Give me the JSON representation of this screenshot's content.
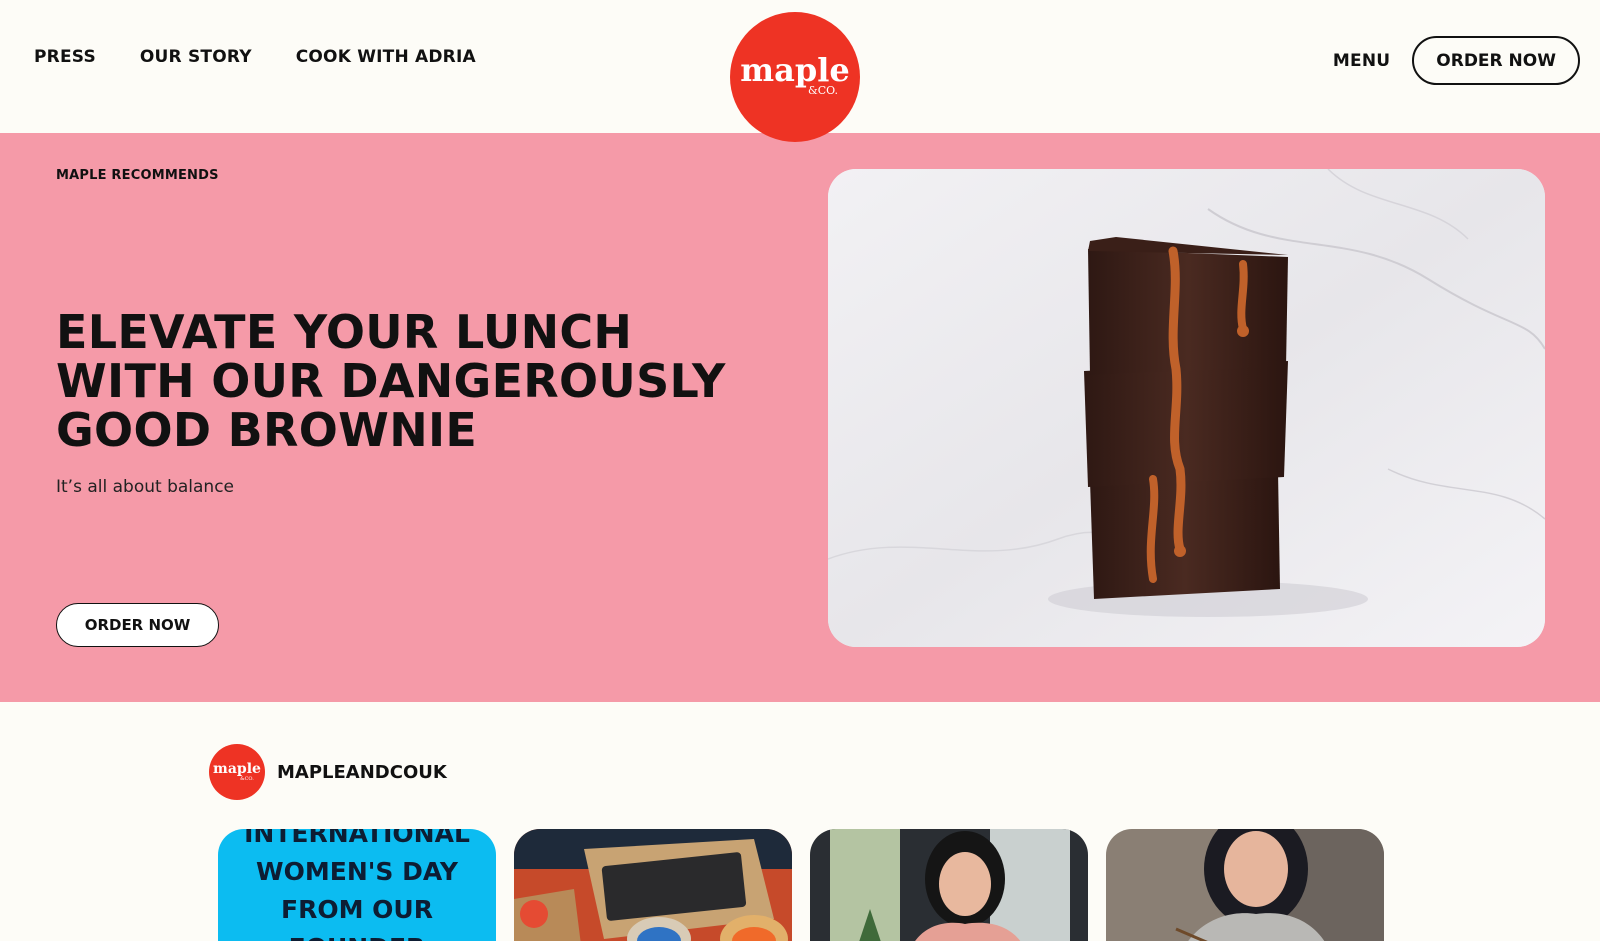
{
  "header": {
    "nav_left": [
      "PRESS",
      "OUR STORY",
      "COOK WITH ADRIA"
    ],
    "logo": {
      "word": "maple",
      "sub": "&CO."
    },
    "menu_label": "MENU",
    "order_label": "ORDER NOW"
  },
  "hero": {
    "eyebrow": "MAPLE RECOMMENDS",
    "title": "ELEVATE YOUR LUNCH WITH OUR DANGEROUSLY GOOD BROWNIE",
    "subtitle": "It’s all about balance",
    "cta": "ORDER NOW",
    "image_icon": "brownie-stack-photo"
  },
  "instagram": {
    "handle": "MAPLEANDCOUK",
    "avatar": {
      "word": "maple",
      "sub": "&CO."
    },
    "tiles": [
      {
        "text": "INTERNATIONAL WOMEN'S DAY FROM OUR FOUNDER",
        "lines": [
          "INTERNATIONAL",
          "WOMEN'S DAY",
          "FROM OUR",
          "FOUNDER"
        ]
      },
      {
        "icon": "laptop-delivery-photo"
      },
      {
        "icon": "woman-cooking-photo"
      },
      {
        "icon": "woman-eating-photo"
      }
    ]
  },
  "colors": {
    "background": "#fdfcf7",
    "brand_red": "#ee3324",
    "hero_pink": "#f59aa8",
    "text": "#111111",
    "tile_blue": "#0cbcf1"
  }
}
